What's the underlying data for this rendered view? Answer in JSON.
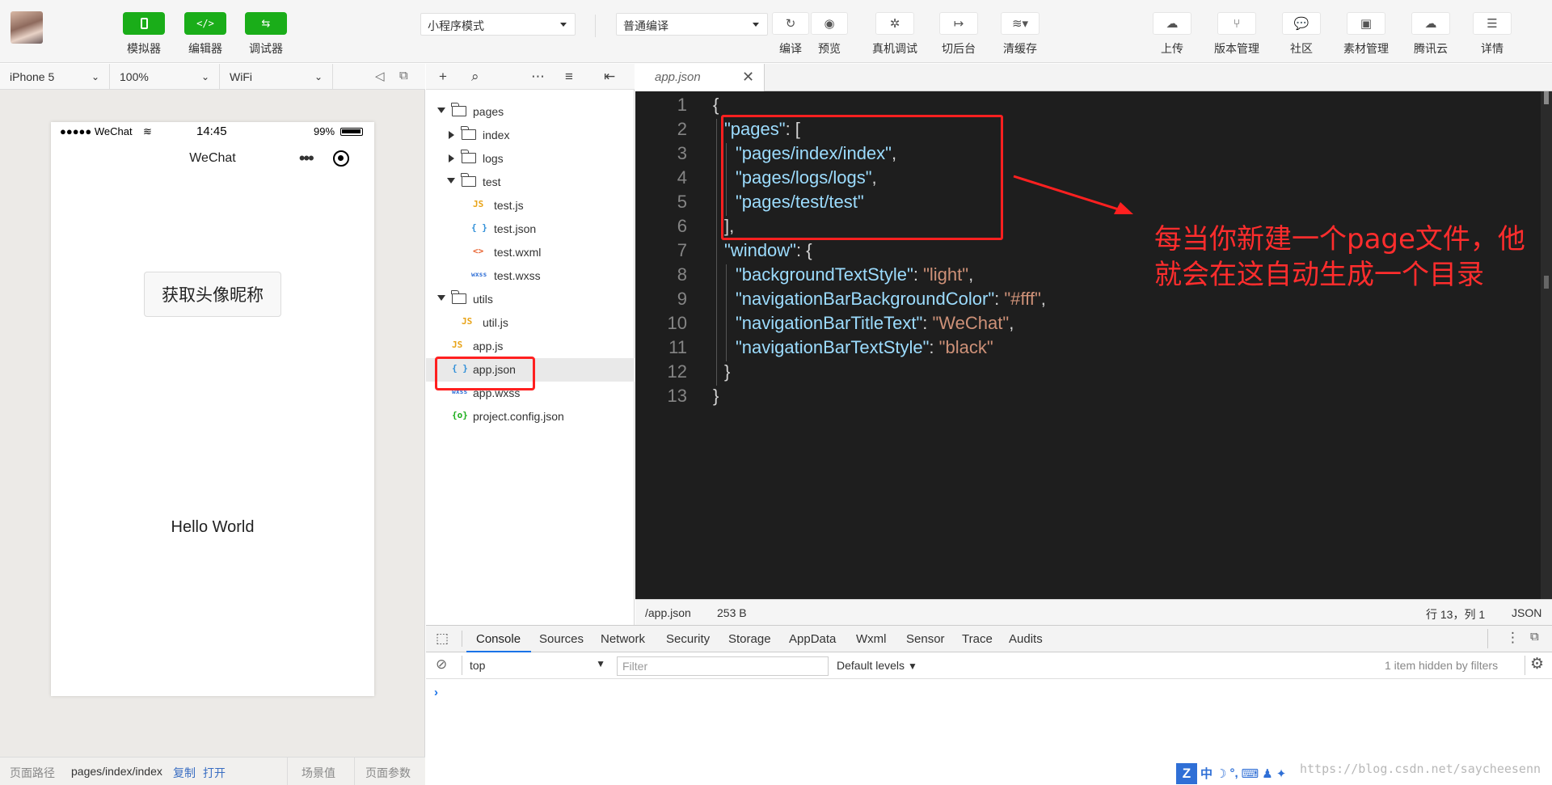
{
  "toolbar": {
    "simulator_label": "模拟器",
    "editor_label": "编辑器",
    "debugger_label": "调试器",
    "mode_select": "小程序模式",
    "compile_select": "普通编译",
    "compile_label": "编译",
    "preview_label": "预览",
    "remote_debug_label": "真机调试",
    "background_label": "切后台",
    "clear_cache_label": "清缓存",
    "upload_label": "上传",
    "version_label": "版本管理",
    "community_label": "社区",
    "assets_label": "素材管理",
    "tencent_cloud_label": "腾讯云",
    "details_label": "详情"
  },
  "simulator": {
    "device": "iPhone 5",
    "zoom": "100%",
    "network": "WiFi",
    "status_signal": "●●●●● WeChat",
    "status_time": "14:45",
    "status_battery": "99%",
    "nav_title": "WeChat",
    "avatar_button": "获取头像昵称",
    "hello_text": "Hello World"
  },
  "sim_footer": {
    "path_label": "页面路径",
    "path_value": "pages/index/index",
    "copy": "复制",
    "open": "打开",
    "scene": "场景值",
    "params": "页面参数"
  },
  "tree": {
    "pages": "pages",
    "index": "index",
    "logs": "logs",
    "test": "test",
    "test_js": "test.js",
    "test_json": "test.json",
    "test_wxml": "test.wxml",
    "test_wxss": "test.wxss",
    "utils": "utils",
    "util_js": "util.js",
    "app_js": "app.js",
    "app_json": "app.json",
    "app_wxss": "app.wxss",
    "project_config": "project.config.json",
    "js_badge": "JS",
    "json_badge": "{ }",
    "wxml_badge": "<>",
    "wxss_badge": "wxss",
    "config_badge": "{o}"
  },
  "editor": {
    "tab_name": "app.json",
    "line_numbers": [
      "1",
      "2",
      "3",
      "4",
      "5",
      "6",
      "7",
      "8",
      "9",
      "10",
      "11",
      "12",
      "13"
    ],
    "code": {
      "open_brace": "{",
      "pages_key": "\"pages\"",
      "pages_open": ": [",
      "page1": "\"pages/index/index\"",
      "page2": "\"pages/logs/logs\"",
      "page3": "\"pages/test/test\"",
      "comma": ",",
      "pages_close": "],",
      "window_key": "\"window\"",
      "window_open": ": {",
      "bts_key": "\"backgroundTextStyle\"",
      "bts_val": "\"light\"",
      "nbbc_key": "\"navigationBarBackgroundColor\"",
      "nbbc_val": "\"#fff\"",
      "nbtt_key": "\"navigationBarTitleText\"",
      "nbtt_val": "\"WeChat\"",
      "nbts_key": "\"navigationBarTextStyle\"",
      "nbts_val": "\"black\"",
      "colon": ": ",
      "inner_close": "}",
      "close_brace": "}"
    },
    "annotation": "每当你新建一个page文件，他就会在这自动生成一个目录",
    "status_path": "/app.json",
    "status_size": "253 B",
    "status_pos": "行 13，列 1",
    "status_lang": "JSON"
  },
  "devtools": {
    "tabs": [
      "Console",
      "Sources",
      "Network",
      "Security",
      "Storage",
      "AppData",
      "Wxml",
      "Sensor",
      "Trace",
      "Audits"
    ],
    "context": "top",
    "filter_placeholder": "Filter",
    "levels": "Default levels",
    "hidden_msg": "1 item hidden by filters",
    "prompt": "›"
  },
  "ime": {
    "chars": [
      "中",
      "☽",
      "°,",
      "⌨",
      "♟",
      "✦"
    ]
  },
  "watermark": "https://blog.csdn.net/saycheesenn"
}
